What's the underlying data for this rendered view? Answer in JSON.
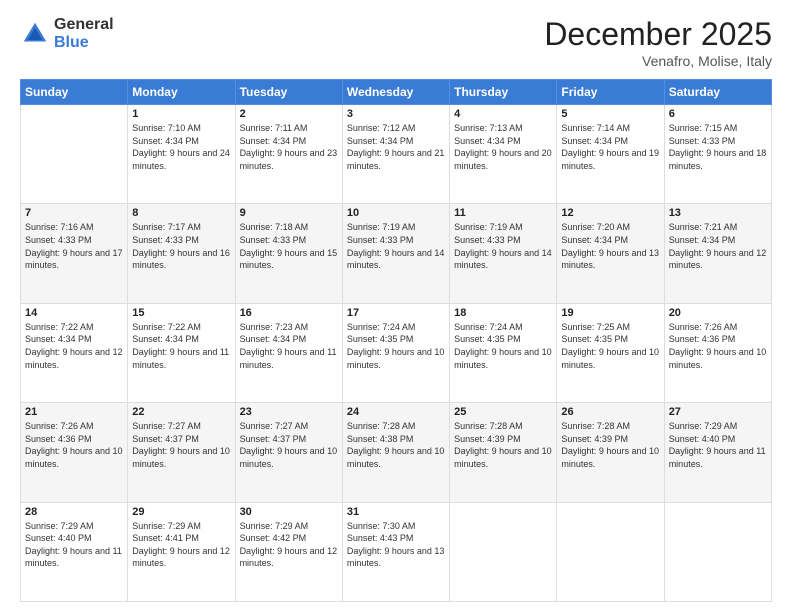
{
  "logo": {
    "general": "General",
    "blue": "Blue"
  },
  "title": "December 2025",
  "subtitle": "Venafro, Molise, Italy",
  "days_of_week": [
    "Sunday",
    "Monday",
    "Tuesday",
    "Wednesday",
    "Thursday",
    "Friday",
    "Saturday"
  ],
  "weeks": [
    [
      {
        "day": "",
        "sunrise": "",
        "sunset": "",
        "daylight": ""
      },
      {
        "day": "1",
        "sunrise": "Sunrise: 7:10 AM",
        "sunset": "Sunset: 4:34 PM",
        "daylight": "Daylight: 9 hours and 24 minutes."
      },
      {
        "day": "2",
        "sunrise": "Sunrise: 7:11 AM",
        "sunset": "Sunset: 4:34 PM",
        "daylight": "Daylight: 9 hours and 23 minutes."
      },
      {
        "day": "3",
        "sunrise": "Sunrise: 7:12 AM",
        "sunset": "Sunset: 4:34 PM",
        "daylight": "Daylight: 9 hours and 21 minutes."
      },
      {
        "day": "4",
        "sunrise": "Sunrise: 7:13 AM",
        "sunset": "Sunset: 4:34 PM",
        "daylight": "Daylight: 9 hours and 20 minutes."
      },
      {
        "day": "5",
        "sunrise": "Sunrise: 7:14 AM",
        "sunset": "Sunset: 4:34 PM",
        "daylight": "Daylight: 9 hours and 19 minutes."
      },
      {
        "day": "6",
        "sunrise": "Sunrise: 7:15 AM",
        "sunset": "Sunset: 4:33 PM",
        "daylight": "Daylight: 9 hours and 18 minutes."
      }
    ],
    [
      {
        "day": "7",
        "sunrise": "Sunrise: 7:16 AM",
        "sunset": "Sunset: 4:33 PM",
        "daylight": "Daylight: 9 hours and 17 minutes."
      },
      {
        "day": "8",
        "sunrise": "Sunrise: 7:17 AM",
        "sunset": "Sunset: 4:33 PM",
        "daylight": "Daylight: 9 hours and 16 minutes."
      },
      {
        "day": "9",
        "sunrise": "Sunrise: 7:18 AM",
        "sunset": "Sunset: 4:33 PM",
        "daylight": "Daylight: 9 hours and 15 minutes."
      },
      {
        "day": "10",
        "sunrise": "Sunrise: 7:19 AM",
        "sunset": "Sunset: 4:33 PM",
        "daylight": "Daylight: 9 hours and 14 minutes."
      },
      {
        "day": "11",
        "sunrise": "Sunrise: 7:19 AM",
        "sunset": "Sunset: 4:33 PM",
        "daylight": "Daylight: 9 hours and 14 minutes."
      },
      {
        "day": "12",
        "sunrise": "Sunrise: 7:20 AM",
        "sunset": "Sunset: 4:34 PM",
        "daylight": "Daylight: 9 hours and 13 minutes."
      },
      {
        "day": "13",
        "sunrise": "Sunrise: 7:21 AM",
        "sunset": "Sunset: 4:34 PM",
        "daylight": "Daylight: 9 hours and 12 minutes."
      }
    ],
    [
      {
        "day": "14",
        "sunrise": "Sunrise: 7:22 AM",
        "sunset": "Sunset: 4:34 PM",
        "daylight": "Daylight: 9 hours and 12 minutes."
      },
      {
        "day": "15",
        "sunrise": "Sunrise: 7:22 AM",
        "sunset": "Sunset: 4:34 PM",
        "daylight": "Daylight: 9 hours and 11 minutes."
      },
      {
        "day": "16",
        "sunrise": "Sunrise: 7:23 AM",
        "sunset": "Sunset: 4:34 PM",
        "daylight": "Daylight: 9 hours and 11 minutes."
      },
      {
        "day": "17",
        "sunrise": "Sunrise: 7:24 AM",
        "sunset": "Sunset: 4:35 PM",
        "daylight": "Daylight: 9 hours and 10 minutes."
      },
      {
        "day": "18",
        "sunrise": "Sunrise: 7:24 AM",
        "sunset": "Sunset: 4:35 PM",
        "daylight": "Daylight: 9 hours and 10 minutes."
      },
      {
        "day": "19",
        "sunrise": "Sunrise: 7:25 AM",
        "sunset": "Sunset: 4:35 PM",
        "daylight": "Daylight: 9 hours and 10 minutes."
      },
      {
        "day": "20",
        "sunrise": "Sunrise: 7:26 AM",
        "sunset": "Sunset: 4:36 PM",
        "daylight": "Daylight: 9 hours and 10 minutes."
      }
    ],
    [
      {
        "day": "21",
        "sunrise": "Sunrise: 7:26 AM",
        "sunset": "Sunset: 4:36 PM",
        "daylight": "Daylight: 9 hours and 10 minutes."
      },
      {
        "day": "22",
        "sunrise": "Sunrise: 7:27 AM",
        "sunset": "Sunset: 4:37 PM",
        "daylight": "Daylight: 9 hours and 10 minutes."
      },
      {
        "day": "23",
        "sunrise": "Sunrise: 7:27 AM",
        "sunset": "Sunset: 4:37 PM",
        "daylight": "Daylight: 9 hours and 10 minutes."
      },
      {
        "day": "24",
        "sunrise": "Sunrise: 7:28 AM",
        "sunset": "Sunset: 4:38 PM",
        "daylight": "Daylight: 9 hours and 10 minutes."
      },
      {
        "day": "25",
        "sunrise": "Sunrise: 7:28 AM",
        "sunset": "Sunset: 4:39 PM",
        "daylight": "Daylight: 9 hours and 10 minutes."
      },
      {
        "day": "26",
        "sunrise": "Sunrise: 7:28 AM",
        "sunset": "Sunset: 4:39 PM",
        "daylight": "Daylight: 9 hours and 10 minutes."
      },
      {
        "day": "27",
        "sunrise": "Sunrise: 7:29 AM",
        "sunset": "Sunset: 4:40 PM",
        "daylight": "Daylight: 9 hours and 11 minutes."
      }
    ],
    [
      {
        "day": "28",
        "sunrise": "Sunrise: 7:29 AM",
        "sunset": "Sunset: 4:40 PM",
        "daylight": "Daylight: 9 hours and 11 minutes."
      },
      {
        "day": "29",
        "sunrise": "Sunrise: 7:29 AM",
        "sunset": "Sunset: 4:41 PM",
        "daylight": "Daylight: 9 hours and 12 minutes."
      },
      {
        "day": "30",
        "sunrise": "Sunrise: 7:29 AM",
        "sunset": "Sunset: 4:42 PM",
        "daylight": "Daylight: 9 hours and 12 minutes."
      },
      {
        "day": "31",
        "sunrise": "Sunrise: 7:30 AM",
        "sunset": "Sunset: 4:43 PM",
        "daylight": "Daylight: 9 hours and 13 minutes."
      },
      {
        "day": "",
        "sunrise": "",
        "sunset": "",
        "daylight": ""
      },
      {
        "day": "",
        "sunrise": "",
        "sunset": "",
        "daylight": ""
      },
      {
        "day": "",
        "sunrise": "",
        "sunset": "",
        "daylight": ""
      }
    ]
  ]
}
